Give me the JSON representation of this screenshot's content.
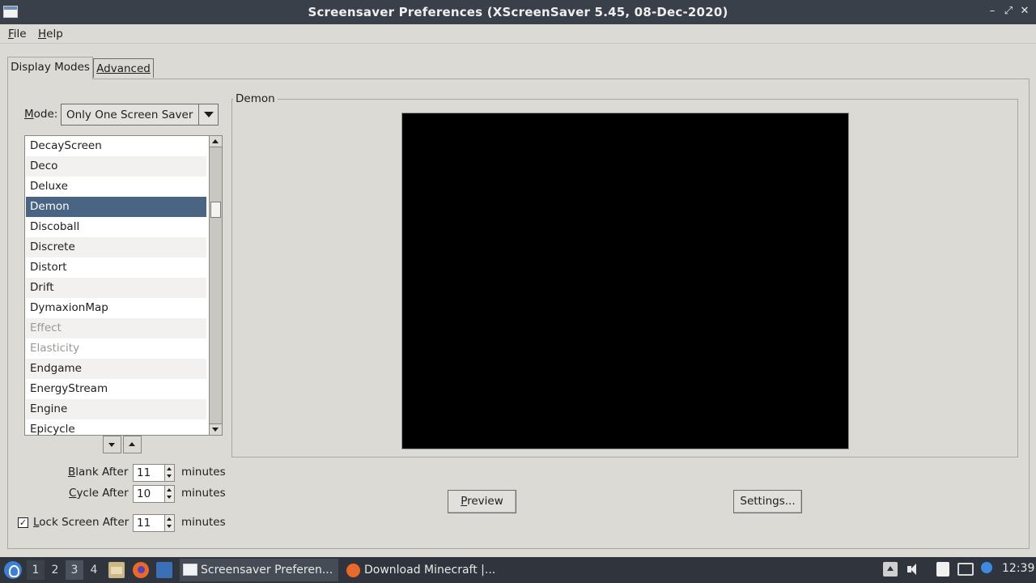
{
  "window": {
    "title": "Screensaver Preferences  (XScreenSaver 5.45, 08-Dec-2020)",
    "controls": [
      "–",
      "⤢",
      "✕"
    ]
  },
  "menu": {
    "file": {
      "underlined": "F",
      "rest": "ile"
    },
    "help": {
      "underlined": "H",
      "rest": "elp"
    }
  },
  "tabs": {
    "display_modes": "Display Modes",
    "advanced": "Advanced"
  },
  "mode": {
    "label_underlined": "M",
    "label_rest": "ode:",
    "value": "Only One Screen Saver"
  },
  "savers": {
    "items": [
      {
        "name": "DecayScreen",
        "state": "normal"
      },
      {
        "name": "Deco",
        "state": "normal"
      },
      {
        "name": "Deluxe",
        "state": "normal"
      },
      {
        "name": "Demon",
        "state": "selected"
      },
      {
        "name": "Discoball",
        "state": "normal"
      },
      {
        "name": "Discrete",
        "state": "normal"
      },
      {
        "name": "Distort",
        "state": "normal"
      },
      {
        "name": "Drift",
        "state": "normal"
      },
      {
        "name": "DymaxionMap",
        "state": "normal"
      },
      {
        "name": "Effect",
        "state": "disabled"
      },
      {
        "name": "Elasticity",
        "state": "disabled"
      },
      {
        "name": "Endgame",
        "state": "normal"
      },
      {
        "name": "EnergyStream",
        "state": "normal"
      },
      {
        "name": "Engine",
        "state": "normal"
      },
      {
        "name": "Epicycle",
        "state": "normal"
      }
    ],
    "scroll_position": 0.2
  },
  "timing": {
    "blank_after": {
      "label_pre": "",
      "label_u": "B",
      "label_post": "lank After",
      "value": "11",
      "unit": "minutes"
    },
    "cycle_after": {
      "label_pre": "",
      "label_u": "C",
      "label_post": "ycle After",
      "value": "10",
      "unit": "minutes"
    },
    "lock_after": {
      "label_pre": "",
      "label_u": "L",
      "label_post": "ock Screen After",
      "value": "11",
      "unit": "minutes",
      "checked": true
    }
  },
  "preview_frame": {
    "label": "Demon"
  },
  "buttons": {
    "preview": {
      "underlined": "P",
      "rest": "review"
    },
    "settings": {
      "underlined": "",
      "rest": "Settings..."
    }
  },
  "taskbar": {
    "workspaces": [
      "1",
      "2",
      "3",
      "4"
    ],
    "active_workspace": "3",
    "tasks": [
      {
        "label": "Screensaver Preferen...",
        "active": true
      },
      {
        "label": "Download Minecraft |...",
        "active": false
      }
    ],
    "clock": "12:39"
  },
  "colors": {
    "selection": "#4a6584",
    "titlebar": "#3a4049",
    "taskbar": "#2f343d",
    "window_bg": "#dcdad5"
  }
}
